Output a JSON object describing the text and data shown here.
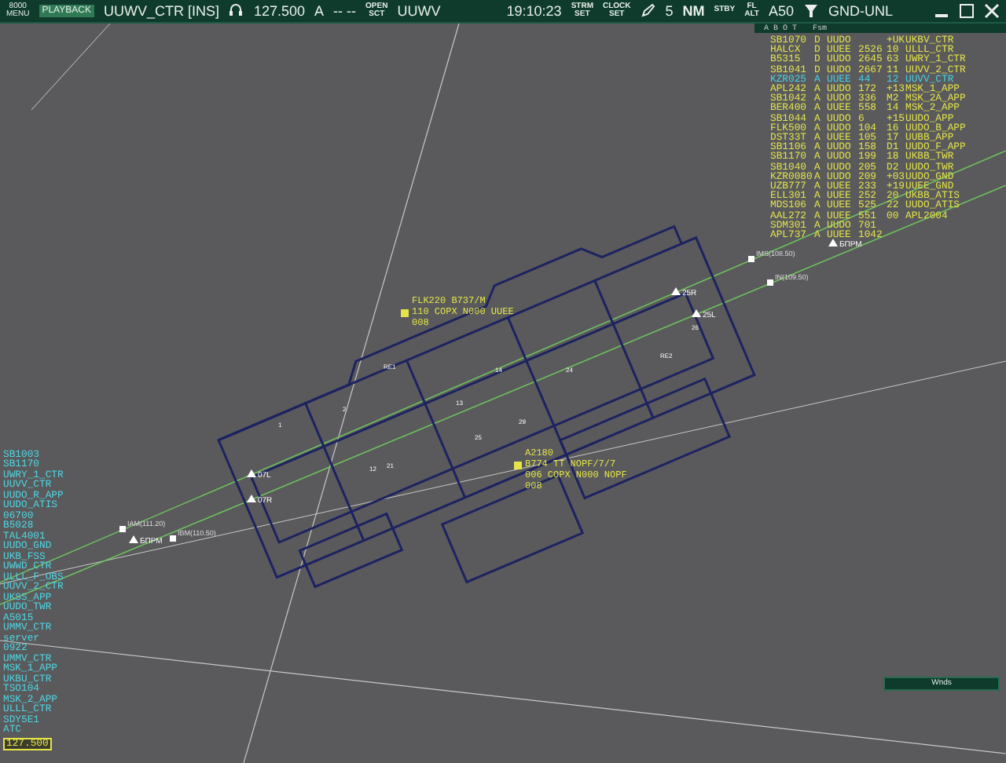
{
  "toolbar": {
    "menu": "8000 MENU",
    "playback": "PLAYBACK",
    "position": "UUWV_CTR [INS]",
    "frequency": "127.500",
    "mode": "A",
    "standby": "-- --",
    "open_sector_label": "OPEN SCT",
    "sector": "UUWV",
    "time": "19:10:23",
    "strm": "STRM SET",
    "clock": "CLOCK SET",
    "range": "5",
    "unit": "NM",
    "stby": "STBY",
    "fl_alt": "FL ALT",
    "altitude": "A50",
    "filter": "GND-UNL"
  },
  "flight_list": {
    "header": [
      "A B O T",
      "Fsm"
    ],
    "rows": [
      {
        "cells": [
          "SB1070",
          "D",
          "UUDO",
          "",
          "+UK",
          "UKBV_CTR"
        ],
        "selected": false
      },
      {
        "cells": [
          "HALCX",
          "D",
          "UUEE",
          "2526",
          "10",
          "ULLL_CTR"
        ],
        "selected": false
      },
      {
        "cells": [
          "B5315",
          "D",
          "UUDO",
          "2645",
          "63",
          "UWRY_1_CTR"
        ],
        "selected": false
      },
      {
        "cells": [
          "SB1041",
          "D",
          "UUDO",
          "2667",
          "11",
          "UUVV_2_CTR"
        ],
        "selected": false
      },
      {
        "cells": [
          "KZR025",
          "A",
          "UUEE",
          "44",
          "12",
          "UUVV_CTR"
        ],
        "selected": true
      },
      {
        "cells": [
          "APL242",
          "A",
          "UUDO",
          "172",
          "+13",
          "MSK_1_APP"
        ],
        "selected": false
      },
      {
        "cells": [
          "SB1042",
          "A",
          "UUDO",
          "336",
          "M2",
          "MSK_2A_APP"
        ],
        "selected": false
      },
      {
        "cells": [
          "BER400",
          "A",
          "UUEE",
          "558",
          "14",
          "MSK_2_APP"
        ],
        "selected": false
      },
      {
        "cells": [
          "SB1044",
          "A",
          "UUDO",
          "6",
          "+15",
          "UUDO_APP"
        ],
        "selected": false
      },
      {
        "cells": [
          "FLK500",
          "A",
          "UUDO",
          "104",
          "16",
          "UUDO_B_APP"
        ],
        "selected": false
      },
      {
        "cells": [
          "DST33T",
          "A",
          "UUEE",
          "105",
          "17",
          "UUBB_APP"
        ],
        "selected": false
      },
      {
        "cells": [
          "SB1106",
          "A",
          "UUDO",
          "158",
          "D1",
          "UUDO_F_APP"
        ],
        "selected": false
      },
      {
        "cells": [
          "SB1170",
          "A",
          "UUDO",
          "199",
          "18",
          "UKBB_TWR"
        ],
        "selected": false
      },
      {
        "cells": [
          "SB1040",
          "A",
          "UUDO",
          "205",
          "D2",
          "UUDO_TWR"
        ],
        "selected": false
      },
      {
        "cells": [
          "KZR0080",
          "A",
          "UUDO",
          "209",
          "+03",
          "UUDO_GND"
        ],
        "selected": false
      },
      {
        "cells": [
          "UZB777",
          "A",
          "UUEE",
          "233",
          "+19",
          "UUEE_GND"
        ],
        "selected": false
      },
      {
        "cells": [
          "ELL301",
          "A",
          "UUEE",
          "252",
          "20",
          "UKBB_ATIS"
        ],
        "selected": false
      },
      {
        "cells": [
          "MDS106",
          "A",
          "UUEE",
          "525",
          "22",
          "UUDO_ATIS"
        ],
        "selected": false
      },
      {
        "cells": [
          "AAL272",
          "A",
          "UUEE",
          "551",
          "00",
          "APL2004"
        ],
        "selected": false
      },
      {
        "cells": [
          "SDM301",
          "A",
          "UUDO",
          "701",
          "",
          ""
        ],
        "selected": false
      },
      {
        "cells": [
          "APL737",
          "A",
          "UUEE",
          "1042",
          "",
          ""
        ],
        "selected": false
      }
    ]
  },
  "station_list": [
    "SB1003",
    "SB1170",
    "UWRY_1_CTR",
    "UUVV_CTR",
    "UUDO_R_APP",
    "UUDO_ATIS",
    "06700",
    "B5028",
    "TAL4001",
    "UUDO_GND",
    "UKB_FSS",
    "UWWD_CTR",
    "ULLL_F_OBS",
    "UUVV_2_CTR",
    "UKSS_APP",
    "UUDO_TWR",
    "A5015",
    "UMMV_CTR",
    "server",
    "0922",
    "UMMV_CTR",
    "MSK_1_APP",
    "UKBU_CTR",
    "TSO104",
    "MSK_2_APP",
    "ULLL_CTR",
    "SDY5E1",
    "ATC"
  ],
  "station_frequency": "127.500",
  "map": {
    "runway_ends": [
      "07L",
      "07R",
      "25R",
      "25L"
    ],
    "fixes": [
      "IMS(108.50)",
      "IN(109.50)",
      "IAM(111.20)",
      "IBM(110.50)"
    ],
    "markers": [
      "БПРМ",
      "БПРМ"
    ],
    "taxiway_labels": [
      "1",
      "2",
      "12",
      "13",
      "14",
      "21",
      "24",
      "25",
      "26",
      "29",
      "RE1",
      "RE2"
    ],
    "aircraft": [
      {
        "lines": [
          "FLK220  B737/M",
          "110 COPX N000 UUEE",
          "008"
        ]
      },
      {
        "lines": [
          "A2180",
          "B774 TT NOPF/7/7",
          "006 COPX N000 NOPF",
          "008"
        ]
      }
    ]
  },
  "wind_panel": {
    "title": "Wnds"
  }
}
